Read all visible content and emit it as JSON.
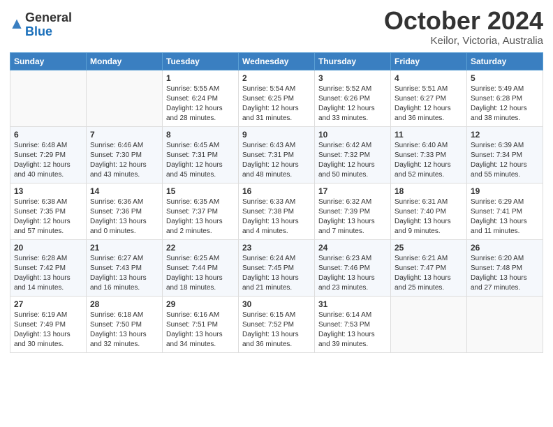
{
  "logo": {
    "general": "General",
    "blue": "Blue"
  },
  "title": "October 2024",
  "location": "Keilor, Victoria, Australia",
  "days_of_week": [
    "Sunday",
    "Monday",
    "Tuesday",
    "Wednesday",
    "Thursday",
    "Friday",
    "Saturday"
  ],
  "weeks": [
    [
      {
        "num": "",
        "detail": ""
      },
      {
        "num": "",
        "detail": ""
      },
      {
        "num": "1",
        "detail": "Sunrise: 5:55 AM\nSunset: 6:24 PM\nDaylight: 12 hours and 28 minutes."
      },
      {
        "num": "2",
        "detail": "Sunrise: 5:54 AM\nSunset: 6:25 PM\nDaylight: 12 hours and 31 minutes."
      },
      {
        "num": "3",
        "detail": "Sunrise: 5:52 AM\nSunset: 6:26 PM\nDaylight: 12 hours and 33 minutes."
      },
      {
        "num": "4",
        "detail": "Sunrise: 5:51 AM\nSunset: 6:27 PM\nDaylight: 12 hours and 36 minutes."
      },
      {
        "num": "5",
        "detail": "Sunrise: 5:49 AM\nSunset: 6:28 PM\nDaylight: 12 hours and 38 minutes."
      }
    ],
    [
      {
        "num": "6",
        "detail": "Sunrise: 6:48 AM\nSunset: 7:29 PM\nDaylight: 12 hours and 40 minutes."
      },
      {
        "num": "7",
        "detail": "Sunrise: 6:46 AM\nSunset: 7:30 PM\nDaylight: 12 hours and 43 minutes."
      },
      {
        "num": "8",
        "detail": "Sunrise: 6:45 AM\nSunset: 7:31 PM\nDaylight: 12 hours and 45 minutes."
      },
      {
        "num": "9",
        "detail": "Sunrise: 6:43 AM\nSunset: 7:31 PM\nDaylight: 12 hours and 48 minutes."
      },
      {
        "num": "10",
        "detail": "Sunrise: 6:42 AM\nSunset: 7:32 PM\nDaylight: 12 hours and 50 minutes."
      },
      {
        "num": "11",
        "detail": "Sunrise: 6:40 AM\nSunset: 7:33 PM\nDaylight: 12 hours and 52 minutes."
      },
      {
        "num": "12",
        "detail": "Sunrise: 6:39 AM\nSunset: 7:34 PM\nDaylight: 12 hours and 55 minutes."
      }
    ],
    [
      {
        "num": "13",
        "detail": "Sunrise: 6:38 AM\nSunset: 7:35 PM\nDaylight: 12 hours and 57 minutes."
      },
      {
        "num": "14",
        "detail": "Sunrise: 6:36 AM\nSunset: 7:36 PM\nDaylight: 13 hours and 0 minutes."
      },
      {
        "num": "15",
        "detail": "Sunrise: 6:35 AM\nSunset: 7:37 PM\nDaylight: 13 hours and 2 minutes."
      },
      {
        "num": "16",
        "detail": "Sunrise: 6:33 AM\nSunset: 7:38 PM\nDaylight: 13 hours and 4 minutes."
      },
      {
        "num": "17",
        "detail": "Sunrise: 6:32 AM\nSunset: 7:39 PM\nDaylight: 13 hours and 7 minutes."
      },
      {
        "num": "18",
        "detail": "Sunrise: 6:31 AM\nSunset: 7:40 PM\nDaylight: 13 hours and 9 minutes."
      },
      {
        "num": "19",
        "detail": "Sunrise: 6:29 AM\nSunset: 7:41 PM\nDaylight: 13 hours and 11 minutes."
      }
    ],
    [
      {
        "num": "20",
        "detail": "Sunrise: 6:28 AM\nSunset: 7:42 PM\nDaylight: 13 hours and 14 minutes."
      },
      {
        "num": "21",
        "detail": "Sunrise: 6:27 AM\nSunset: 7:43 PM\nDaylight: 13 hours and 16 minutes."
      },
      {
        "num": "22",
        "detail": "Sunrise: 6:25 AM\nSunset: 7:44 PM\nDaylight: 13 hours and 18 minutes."
      },
      {
        "num": "23",
        "detail": "Sunrise: 6:24 AM\nSunset: 7:45 PM\nDaylight: 13 hours and 21 minutes."
      },
      {
        "num": "24",
        "detail": "Sunrise: 6:23 AM\nSunset: 7:46 PM\nDaylight: 13 hours and 23 minutes."
      },
      {
        "num": "25",
        "detail": "Sunrise: 6:21 AM\nSunset: 7:47 PM\nDaylight: 13 hours and 25 minutes."
      },
      {
        "num": "26",
        "detail": "Sunrise: 6:20 AM\nSunset: 7:48 PM\nDaylight: 13 hours and 27 minutes."
      }
    ],
    [
      {
        "num": "27",
        "detail": "Sunrise: 6:19 AM\nSunset: 7:49 PM\nDaylight: 13 hours and 30 minutes."
      },
      {
        "num": "28",
        "detail": "Sunrise: 6:18 AM\nSunset: 7:50 PM\nDaylight: 13 hours and 32 minutes."
      },
      {
        "num": "29",
        "detail": "Sunrise: 6:16 AM\nSunset: 7:51 PM\nDaylight: 13 hours and 34 minutes."
      },
      {
        "num": "30",
        "detail": "Sunrise: 6:15 AM\nSunset: 7:52 PM\nDaylight: 13 hours and 36 minutes."
      },
      {
        "num": "31",
        "detail": "Sunrise: 6:14 AM\nSunset: 7:53 PM\nDaylight: 13 hours and 39 minutes."
      },
      {
        "num": "",
        "detail": ""
      },
      {
        "num": "",
        "detail": ""
      }
    ]
  ]
}
